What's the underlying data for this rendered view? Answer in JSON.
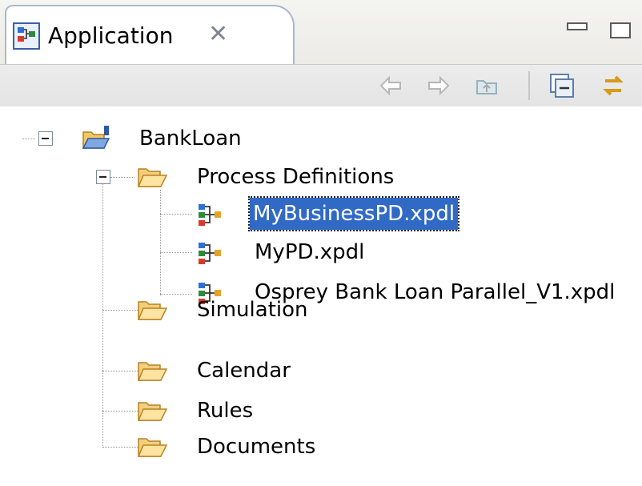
{
  "view": {
    "title": "Application",
    "close_icon": "close-x-icon"
  },
  "toolbar": {
    "buttons": [
      "back-arrow-icon",
      "forward-arrow-icon",
      "up-folder-icon",
      "collapse-all-icon",
      "link-with-editor-icon"
    ]
  },
  "tree": {
    "project": "BankLoan",
    "process_definitions": "Process Definitions",
    "files": [
      "MyBusinessPD.xpdl",
      "MyPD.xpdl",
      "Osprey Bank Loan Parallel_V1.xpdl"
    ],
    "selected_file": "MyBusinessPD.xpdl",
    "folders": [
      "Simulation",
      "Calendar",
      "Rules",
      "Documents"
    ]
  },
  "colors": {
    "selection": "#316ac5",
    "folder": "#e9b44c"
  }
}
